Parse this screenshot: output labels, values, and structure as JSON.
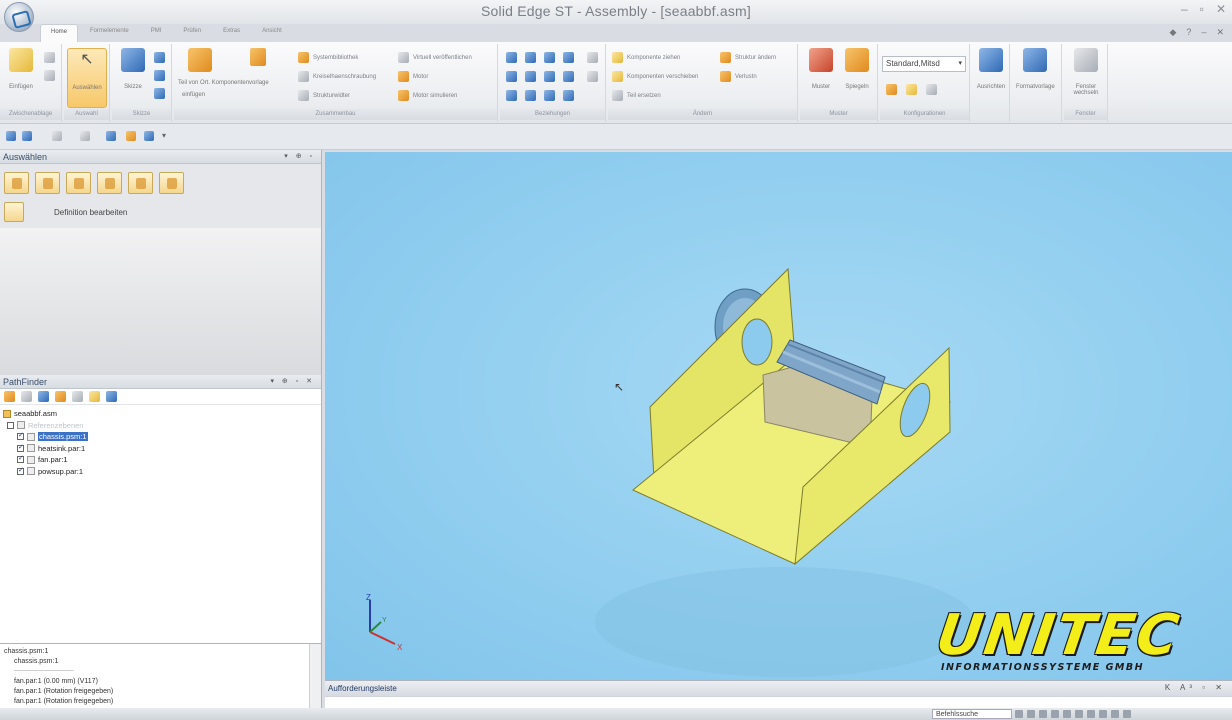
{
  "window": {
    "title": "Solid Edge ST - Assembly - [seaabbf.asm]",
    "controls": [
      "–",
      "▫",
      "✕"
    ]
  },
  "ribbon": {
    "tabs": [
      "Home",
      "Formelemente",
      "PMI",
      "Prüfen",
      "Extras",
      "Ansicht"
    ],
    "active_tab": "Home",
    "groups": {
      "clipboard": {
        "label": "Zwischenablage",
        "paste": "Einfügen"
      },
      "select": {
        "label": "Auswahl",
        "select_tool": "Auswählen"
      },
      "sketch": {
        "label": "Skizze",
        "sketch_tool": "Skizze"
      },
      "assemble": {
        "label": "Zusammenbau",
        "insert_part": "Teil von Ort. Komponentenvorlage",
        "insert_part_line2": "einfügen",
        "items": [
          "Systembibliothek",
          "Kreiselhaenschraubung",
          "Strukturwidter",
          "Virtuell veröffentlichen",
          "Motor",
          "Motor simulieren"
        ]
      },
      "relations": {
        "label": "Beziehungen"
      },
      "modify": {
        "label": "Ändern",
        "items": [
          "Komponente ziehen",
          "Komponenten verschieben",
          "Teil ersetzen",
          "Struktur ändern",
          "Verlustn"
        ]
      },
      "pattern": {
        "label": "Muster",
        "pattern": "Muster",
        "mirror": "Spiegeln"
      },
      "configurations": {
        "label": "Konfigurationen",
        "dropdown_value": "Standard,Mitsd"
      },
      "show": {
        "show_label": "Ausrichten",
        "format_label": "Formatvorlage"
      },
      "window": {
        "label": "Fenster",
        "switch_label": "Fenster wechseln"
      }
    }
  },
  "select_panel": {
    "title": "Auswählen",
    "controls": "▾ ⊕ ▫",
    "edit_definition": "Definition bearbeiten"
  },
  "pathfinder": {
    "title": "PathFinder",
    "controls": "▾ ⊕ ▫ ✕",
    "tree": [
      {
        "label": "seaabbf.asm",
        "level": 0
      },
      {
        "label": "Referenzebenen",
        "level": 1,
        "faded": true
      },
      {
        "label": "chassis.psm:1",
        "level": 1,
        "checked": true,
        "selected": true
      },
      {
        "label": "heatsink.par:1",
        "level": 1,
        "checked": true
      },
      {
        "label": "fan.par:1",
        "level": 1,
        "checked": true
      },
      {
        "label": "powsup.par:1",
        "level": 1,
        "checked": true
      }
    ]
  },
  "relationships_panel": {
    "rows": [
      "chassis.psm:1",
      "chassis.psm:1",
      "fan.par:1    (0.00 mm)    (V117)",
      "fan.par:1    (Rotation freigegeben)",
      "fan.par:1    (Rotation freigegeben)"
    ]
  },
  "viewport": {
    "triad": {
      "z": "Z",
      "x": "X",
      "y": "Y"
    }
  },
  "logo": {
    "main": "UNITEC",
    "sub": "INFORMATIONSSYSTEME GMBH"
  },
  "prompt_bar": {
    "title": "Aufforderungsleiste",
    "controls": "K A³ ▫ ✕"
  },
  "statusbar": {
    "command_search": "Befehlssuche"
  },
  "colors": {
    "viewport_bg": "#8ccbee",
    "chassis_yellow": "#eaeb6c",
    "heatsink_blue": "#7fa6c8",
    "logo_yellow": "#f3ee19"
  }
}
